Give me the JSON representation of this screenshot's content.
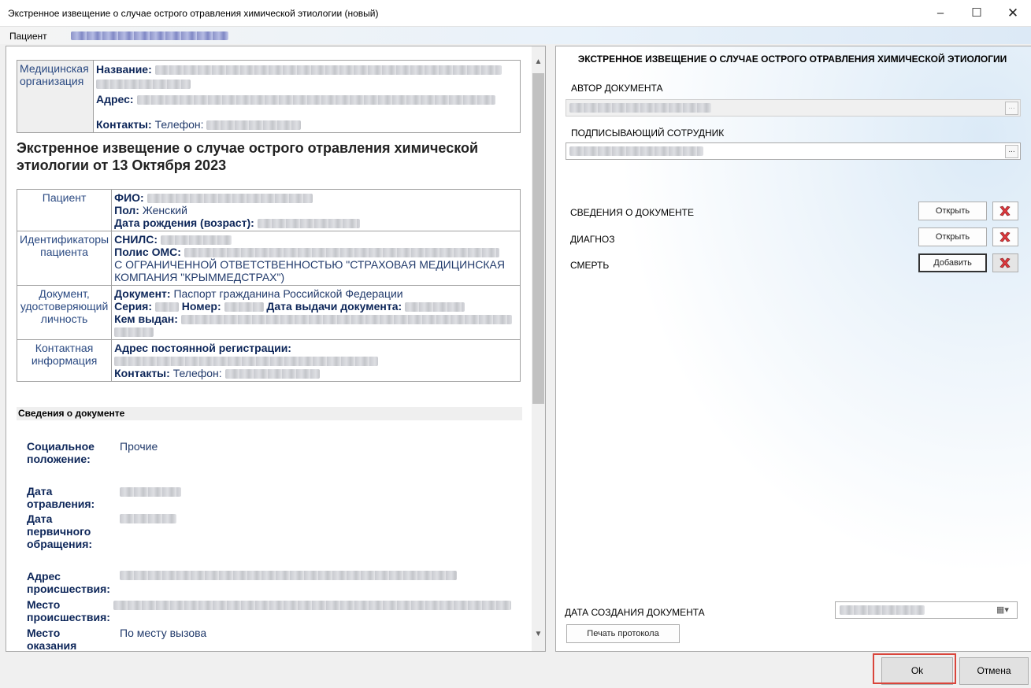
{
  "window": {
    "title": "Экстренное извещение о случае острого отравления химической этиологии (новый)",
    "minimize_icon": "minimize-icon",
    "maximize_icon": "maximize-icon",
    "close_icon": "close-icon"
  },
  "patient_bar": {
    "label": "Пациент"
  },
  "organization": {
    "label": "Медицинская организация",
    "name_key": "Название:",
    "address_key": "Адрес:",
    "contacts_key": "Контакты:",
    "phone_label": "Телефон:"
  },
  "document_heading": "Экстренное извещение о случае острого отравления химической этиологии от 13 Октября 2023",
  "patient_table": {
    "patient_label": "Пациент",
    "fio_key": "ФИО:",
    "sex_key": "Пол:",
    "sex_value": "Женский",
    "dob_key": "Дата рождения (возраст):",
    "ids_label": "Идентификаторы пациента",
    "snils_key": "СНИЛС:",
    "oms_key": "Полис ОМС:",
    "oms_insurer": "С ОГРАНИЧЕННОЙ ОТВЕТСТВЕННОСТЬЮ \"СТРАХОВАЯ МЕДИЦИНСКАЯ КОМПАНИЯ \"КРЫММЕДСТРАХ\")",
    "id_doc_label": "Документ, удостоверяющий личность",
    "doc_key": "Документ:",
    "doc_value": "Паспорт гражданина Российской Федерации",
    "series_key": "Серия:",
    "number_key": "Номер:",
    "issue_date_key": "Дата выдачи документа:",
    "issued_by_key": "Кем выдан:",
    "contact_label": "Контактная информация",
    "reg_address_key": "Адрес постоянной регистрации:",
    "contacts_key": "Контакты:",
    "phone_label": "Телефон:"
  },
  "doc_section": {
    "title": "Сведения о документе",
    "social_label": "Социальное положение:",
    "social_value": "Прочие",
    "poison_date_label": "Дата отравления:",
    "first_visit_label": "Дата первичного обращения:",
    "incident_address_label": "Адрес происшествия:",
    "incident_place_label": "Место происшествия:",
    "aid_place_label": "Место оказания",
    "aid_place_value": "По месту вызова"
  },
  "right_panel": {
    "title": "ЭКСТРЕННОЕ ИЗВЕЩЕНИЕ О СЛУЧАЕ ОСТРОГО ОТРАВЛЕНИЯ ХИМИЧЕСКОЙ ЭТИОЛОГИИ",
    "author_label": "АВТОР ДОКУМЕНТА",
    "signer_label": "ПОДПИСЫВАЮЩИЙ СОТРУДНИК",
    "ellipsis": "...",
    "rows": [
      {
        "label": "СВЕДЕНИЯ О ДОКУМЕНТЕ",
        "button": "Открыть"
      },
      {
        "label": "ДИАГНОЗ",
        "button": "Открыть"
      },
      {
        "label": "СМЕРТЬ",
        "button": "Добавить"
      }
    ],
    "creation_date_label": "ДАТА СОЗДАНИЯ ДОКУМЕНТА",
    "print_button": "Печать протокола"
  },
  "footer": {
    "ok_button": "Ok",
    "cancel_button": "Отмена"
  },
  "colors": {
    "highlight": "#d9453b",
    "label_blue": "#2b4a82",
    "value_blue": "#213a6b"
  }
}
